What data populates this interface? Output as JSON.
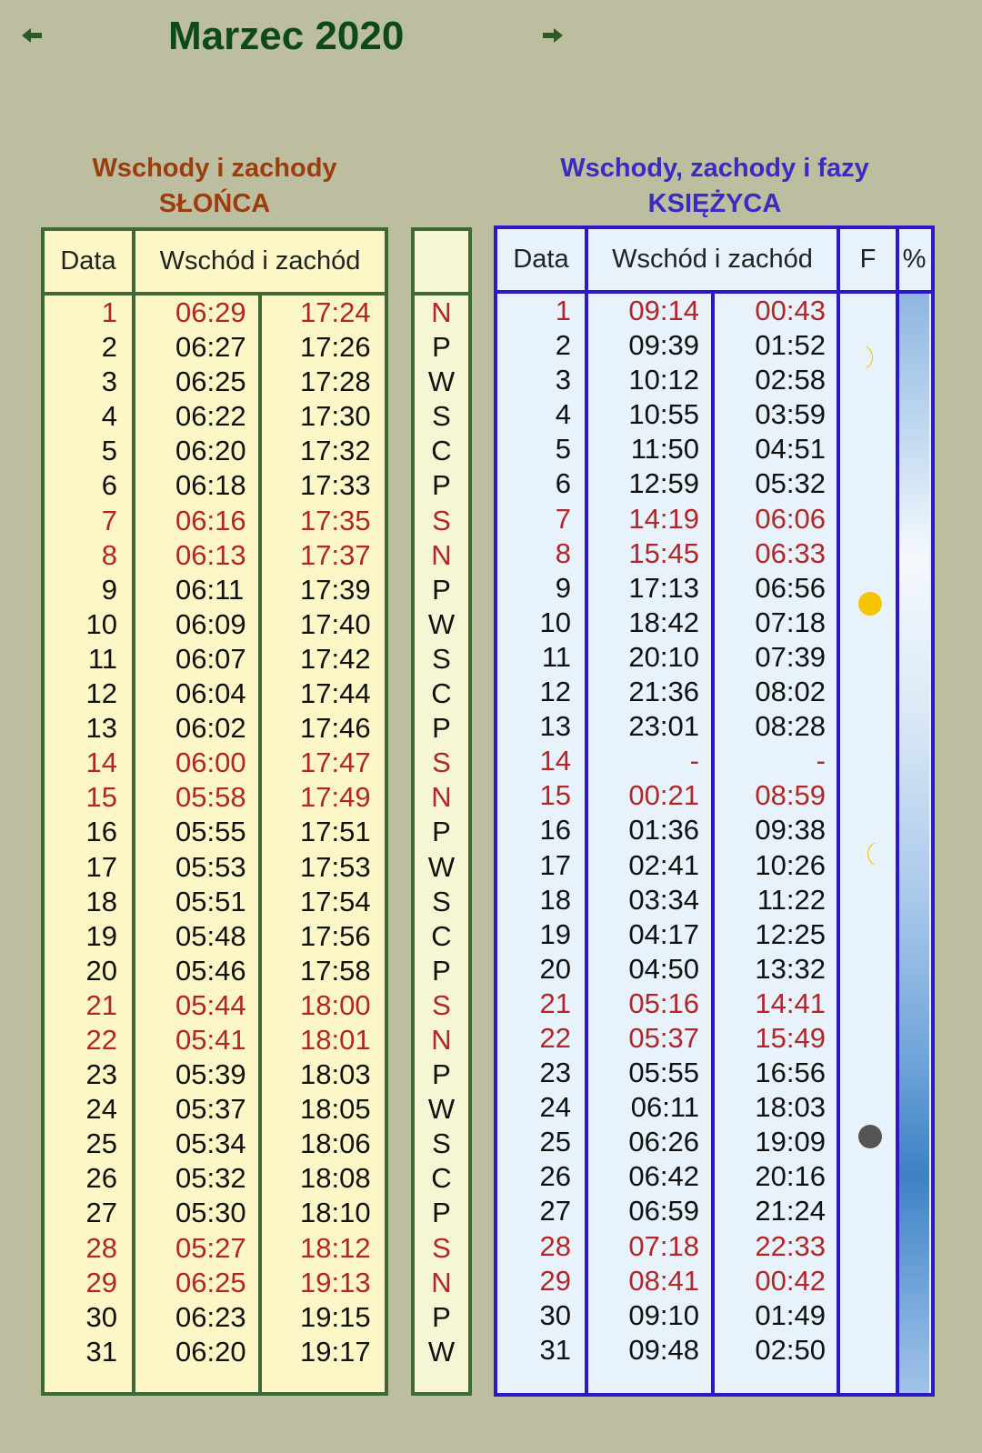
{
  "header": {
    "title": "Marzec 2020"
  },
  "sun": {
    "title_line1": "Wschody i zachody",
    "title_line2": "SŁOŃCA",
    "col_date": "Data",
    "col_rise_set": "Wschód i zachód",
    "rows": [
      {
        "day": "1",
        "rise": "06:29",
        "set": "17:24",
        "dow": "N",
        "we": true
      },
      {
        "day": "2",
        "rise": "06:27",
        "set": "17:26",
        "dow": "P",
        "we": false
      },
      {
        "day": "3",
        "rise": "06:25",
        "set": "17:28",
        "dow": "W",
        "we": false
      },
      {
        "day": "4",
        "rise": "06:22",
        "set": "17:30",
        "dow": "S",
        "we": false
      },
      {
        "day": "5",
        "rise": "06:20",
        "set": "17:32",
        "dow": "C",
        "we": false
      },
      {
        "day": "6",
        "rise": "06:18",
        "set": "17:33",
        "dow": "P",
        "we": false
      },
      {
        "day": "7",
        "rise": "06:16",
        "set": "17:35",
        "dow": "S",
        "we": true
      },
      {
        "day": "8",
        "rise": "06:13",
        "set": "17:37",
        "dow": "N",
        "we": true
      },
      {
        "day": "9",
        "rise": "06:11",
        "set": "17:39",
        "dow": "P",
        "we": false
      },
      {
        "day": "10",
        "rise": "06:09",
        "set": "17:40",
        "dow": "W",
        "we": false
      },
      {
        "day": "11",
        "rise": "06:07",
        "set": "17:42",
        "dow": "S",
        "we": false
      },
      {
        "day": "12",
        "rise": "06:04",
        "set": "17:44",
        "dow": "C",
        "we": false
      },
      {
        "day": "13",
        "rise": "06:02",
        "set": "17:46",
        "dow": "P",
        "we": false
      },
      {
        "day": "14",
        "rise": "06:00",
        "set": "17:47",
        "dow": "S",
        "we": true
      },
      {
        "day": "15",
        "rise": "05:58",
        "set": "17:49",
        "dow": "N",
        "we": true
      },
      {
        "day": "16",
        "rise": "05:55",
        "set": "17:51",
        "dow": "P",
        "we": false
      },
      {
        "day": "17",
        "rise": "05:53",
        "set": "17:53",
        "dow": "W",
        "we": false
      },
      {
        "day": "18",
        "rise": "05:51",
        "set": "17:54",
        "dow": "S",
        "we": false
      },
      {
        "day": "19",
        "rise": "05:48",
        "set": "17:56",
        "dow": "C",
        "we": false
      },
      {
        "day": "20",
        "rise": "05:46",
        "set": "17:58",
        "dow": "P",
        "we": false
      },
      {
        "day": "21",
        "rise": "05:44",
        "set": "18:00",
        "dow": "S",
        "we": true
      },
      {
        "day": "22",
        "rise": "05:41",
        "set": "18:01",
        "dow": "N",
        "we": true
      },
      {
        "day": "23",
        "rise": "05:39",
        "set": "18:03",
        "dow": "P",
        "we": false
      },
      {
        "day": "24",
        "rise": "05:37",
        "set": "18:05",
        "dow": "W",
        "we": false
      },
      {
        "day": "25",
        "rise": "05:34",
        "set": "18:06",
        "dow": "S",
        "we": false
      },
      {
        "day": "26",
        "rise": "05:32",
        "set": "18:08",
        "dow": "C",
        "we": false
      },
      {
        "day": "27",
        "rise": "05:30",
        "set": "18:10",
        "dow": "P",
        "we": false
      },
      {
        "day": "28",
        "rise": "05:27",
        "set": "18:12",
        "dow": "S",
        "we": true
      },
      {
        "day": "29",
        "rise": "06:25",
        "set": "19:13",
        "dow": "N",
        "we": true
      },
      {
        "day": "30",
        "rise": "06:23",
        "set": "19:15",
        "dow": "P",
        "we": false
      },
      {
        "day": "31",
        "rise": "06:20",
        "set": "19:17",
        "dow": "W",
        "we": false
      }
    ]
  },
  "moon": {
    "title_line1": "Wschody, zachody i fazy",
    "title_line2": "KSIĘŻYCA",
    "col_date": "Data",
    "col_rise_set": "Wschód i zachód",
    "col_phase": "F",
    "col_percent": "%",
    "phases": [
      {
        "day": 2,
        "phase": "first-quarter"
      },
      {
        "day": 9,
        "phase": "full-moon"
      },
      {
        "day": 16,
        "phase": "last-quarter"
      },
      {
        "day": 24,
        "phase": "new-moon"
      }
    ],
    "rows": [
      {
        "day": "1",
        "rise": "09:14",
        "set": "00:43",
        "we": true
      },
      {
        "day": "2",
        "rise": "09:39",
        "set": "01:52",
        "we": false
      },
      {
        "day": "3",
        "rise": "10:12",
        "set": "02:58",
        "we": false
      },
      {
        "day": "4",
        "rise": "10:55",
        "set": "03:59",
        "we": false
      },
      {
        "day": "5",
        "rise": "11:50",
        "set": "04:51",
        "we": false
      },
      {
        "day": "6",
        "rise": "12:59",
        "set": "05:32",
        "we": false
      },
      {
        "day": "7",
        "rise": "14:19",
        "set": "06:06",
        "we": true
      },
      {
        "day": "8",
        "rise": "15:45",
        "set": "06:33",
        "we": true
      },
      {
        "day": "9",
        "rise": "17:13",
        "set": "06:56",
        "we": false
      },
      {
        "day": "10",
        "rise": "18:42",
        "set": "07:18",
        "we": false
      },
      {
        "day": "11",
        "rise": "20:10",
        "set": "07:39",
        "we": false
      },
      {
        "day": "12",
        "rise": "21:36",
        "set": "08:02",
        "we": false
      },
      {
        "day": "13",
        "rise": "23:01",
        "set": "08:28",
        "we": false
      },
      {
        "day": "14",
        "rise": "-",
        "set": "-",
        "we": true
      },
      {
        "day": "15",
        "rise": "00:21",
        "set": "08:59",
        "we": true
      },
      {
        "day": "16",
        "rise": "01:36",
        "set": "09:38",
        "we": false
      },
      {
        "day": "17",
        "rise": "02:41",
        "set": "10:26",
        "we": false
      },
      {
        "day": "18",
        "rise": "03:34",
        "set": "11:22",
        "we": false
      },
      {
        "day": "19",
        "rise": "04:17",
        "set": "12:25",
        "we": false
      },
      {
        "day": "20",
        "rise": "04:50",
        "set": "13:32",
        "we": false
      },
      {
        "day": "21",
        "rise": "05:16",
        "set": "14:41",
        "we": true
      },
      {
        "day": "22",
        "rise": "05:37",
        "set": "15:49",
        "we": true
      },
      {
        "day": "23",
        "rise": "05:55",
        "set": "16:56",
        "we": false
      },
      {
        "day": "24",
        "rise": "06:11",
        "set": "18:03",
        "we": false
      },
      {
        "day": "25",
        "rise": "06:26",
        "set": "19:09",
        "we": false
      },
      {
        "day": "26",
        "rise": "06:42",
        "set": "20:16",
        "we": false
      },
      {
        "day": "27",
        "rise": "06:59",
        "set": "21:24",
        "we": false
      },
      {
        "day": "28",
        "rise": "07:18",
        "set": "22:33",
        "we": true
      },
      {
        "day": "29",
        "rise": "08:41",
        "set": "00:42",
        "we": true
      },
      {
        "day": "30",
        "rise": "09:10",
        "set": "01:49",
        "we": false
      },
      {
        "day": "31",
        "rise": "09:48",
        "set": "02:50",
        "we": false
      }
    ]
  },
  "colors": {
    "background": "#bdbd9f",
    "title": "#0d4a17",
    "sun_title": "#9c3d0e",
    "moon_title": "#3a2bc4",
    "weekend_text": "#b0262b",
    "sun_border": "#3f6a36",
    "moon_border": "#2f16c8",
    "phase_icon": "#f5c400",
    "new_moon_icon": "#555555"
  }
}
